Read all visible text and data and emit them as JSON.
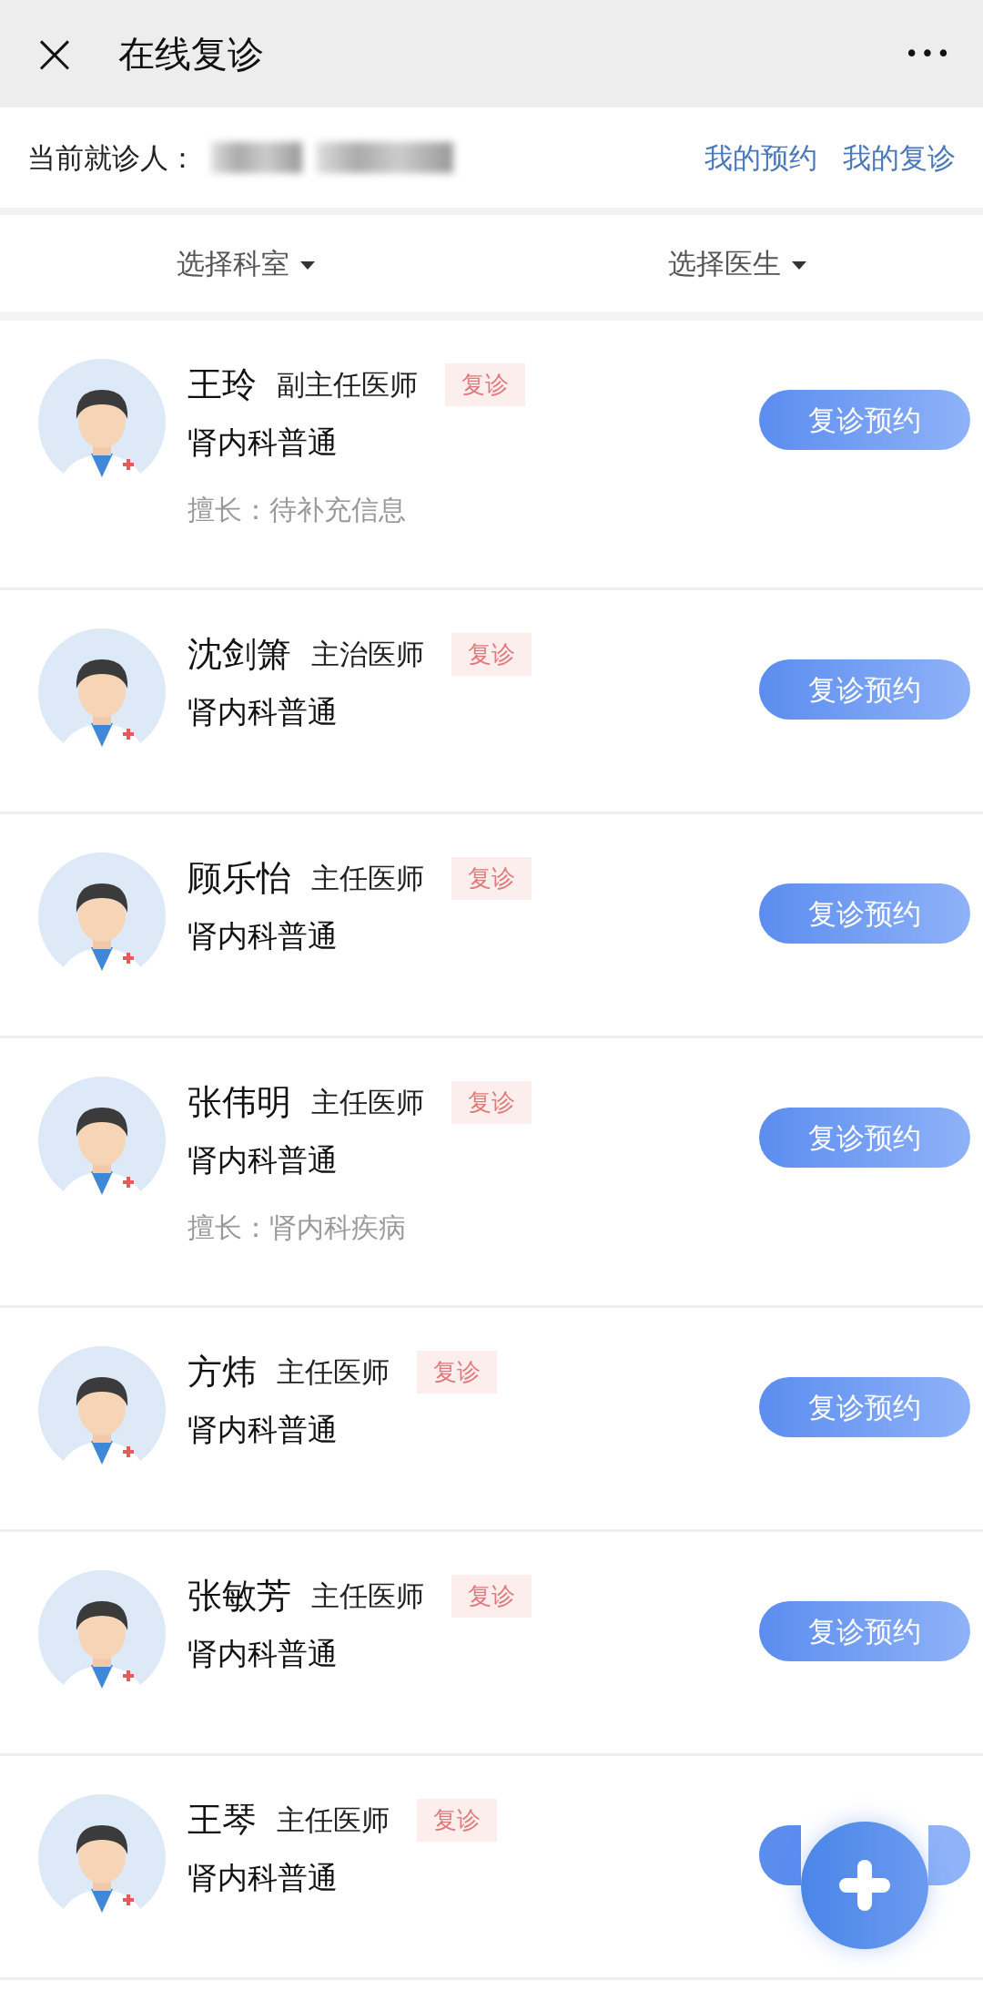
{
  "header": {
    "close": "×",
    "title": "在线复诊",
    "more": "•••"
  },
  "patient_bar": {
    "label": "当前就诊人：",
    "links": [
      "我的预约",
      "我的复诊"
    ]
  },
  "filters": [
    {
      "label": "选择科室"
    },
    {
      "label": "选择医生"
    }
  ],
  "doctors": [
    {
      "name": "王玲",
      "title": "副主任医师",
      "tag": "复诊",
      "department": "肾内科普通",
      "specialty": "擅长：待补充信息",
      "button": "复诊预约"
    },
    {
      "name": "沈剑箫",
      "title": "主治医师",
      "tag": "复诊",
      "department": "肾内科普通",
      "button": "复诊预约"
    },
    {
      "name": "顾乐怡",
      "title": "主任医师",
      "tag": "复诊",
      "department": "肾内科普通",
      "button": "复诊预约"
    },
    {
      "name": "张伟明",
      "title": "主任医师",
      "tag": "复诊",
      "department": "肾内科普通",
      "specialty": "擅长：肾内科疾病",
      "button": "复诊预约"
    },
    {
      "name": "方炜",
      "title": "主任医师",
      "tag": "复诊",
      "department": "肾内科普通",
      "button": "复诊预约"
    },
    {
      "name": "张敏芳",
      "title": "主任医师",
      "tag": "复诊",
      "department": "肾内科普通",
      "button": "复诊预约"
    },
    {
      "name": "王琴",
      "title": "主任医师",
      "tag": "复诊",
      "department": "肾内科普通"
    }
  ]
}
